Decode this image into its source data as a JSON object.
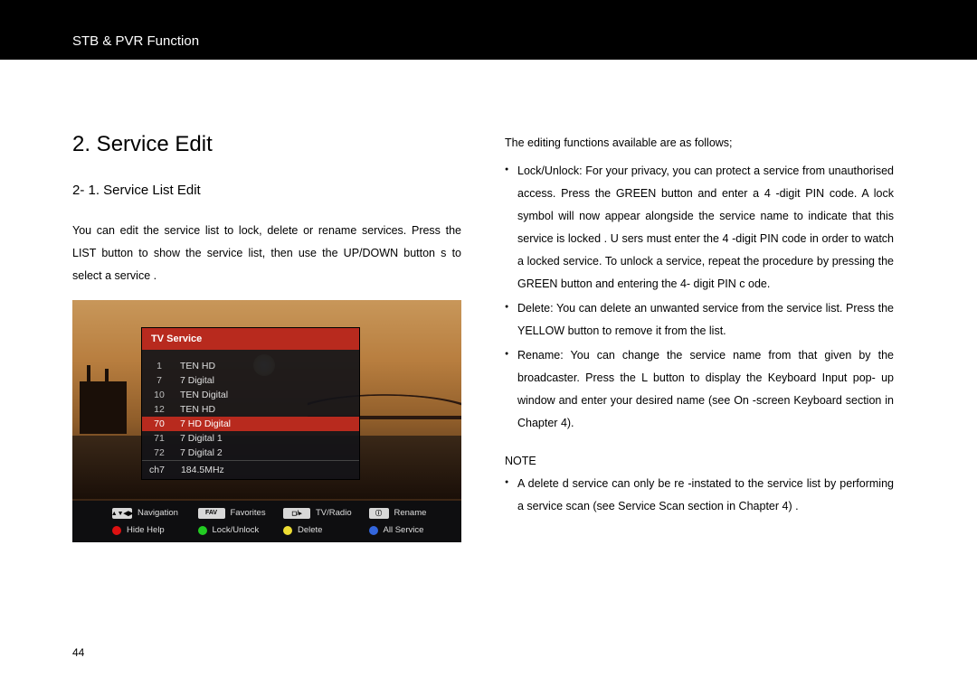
{
  "header": {
    "title": "STB & PVR Function"
  },
  "section": {
    "number_title": "2.  Service Edit",
    "sub_title": "2- 1.  Service List Edit",
    "intro": "You can edit the service list to lock, delete or rename services.        Press the  LIST   button to show the service list, then use the       UP/DOWN button  s to select a service   ."
  },
  "right": {
    "intro": "The editing functions available are as follows;",
    "bullets": [
      "Lock/Unlock: For your privacy, you can protect a service from unauthorised access.    Press the GREEN button and enter a 4   -digit PIN code.  A   lock symbol will   now appear alongside the service name to indicate that this service is locked      . U sers must enter the 4   -digit PIN code in order to watch a locked service.      To unlock a service, repeat the procedure by pressing the     GREEN  button and entering the 4- digit PIN c  ode.",
      "Delete: You can delete an unwanted service from the service list. Press the YELLOW  button to remove it from the list.",
      "Rename: You can change the service name from that given by the broadcaster.    Press the   L  button to display the Keyboard Input pop- up window and enter your desired name (see On     -screen Keyboard  section in Chapter 4)."
    ],
    "note_label": "NOTE",
    "note_bullet": "A delete d service can only be re   -instated to the service list by performing a service scan (see  Service Scan  section in Chapter 4)           ."
  },
  "tv": {
    "panel_title": "TV Service",
    "rows": [
      {
        "num": "1",
        "name": "TEN HD"
      },
      {
        "num": "7",
        "name": "7 Digital"
      },
      {
        "num": "10",
        "name": "TEN Digital"
      },
      {
        "num": "12",
        "name": "TEN HD"
      },
      {
        "num": "70",
        "name": "7 HD Digital",
        "selected": true
      },
      {
        "num": "71",
        "name": "7 Digital 1"
      },
      {
        "num": "72",
        "name": "7 Digital 2"
      }
    ],
    "footer": {
      "ch": "ch7",
      "freq": "184.5MHz"
    },
    "help": {
      "navigation": "Navigation",
      "favorites": "Favorites",
      "tvradio": "TV/Radio",
      "rename": "Rename",
      "hidehelp": "Hide Help",
      "lockunlock": "Lock/Unlock",
      "delete": "Delete",
      "allservice": "All Service",
      "fav_key": "FAV",
      "tvr_key": "◻/▸",
      "ren_key": "ⓘ"
    }
  },
  "page_number": "44"
}
